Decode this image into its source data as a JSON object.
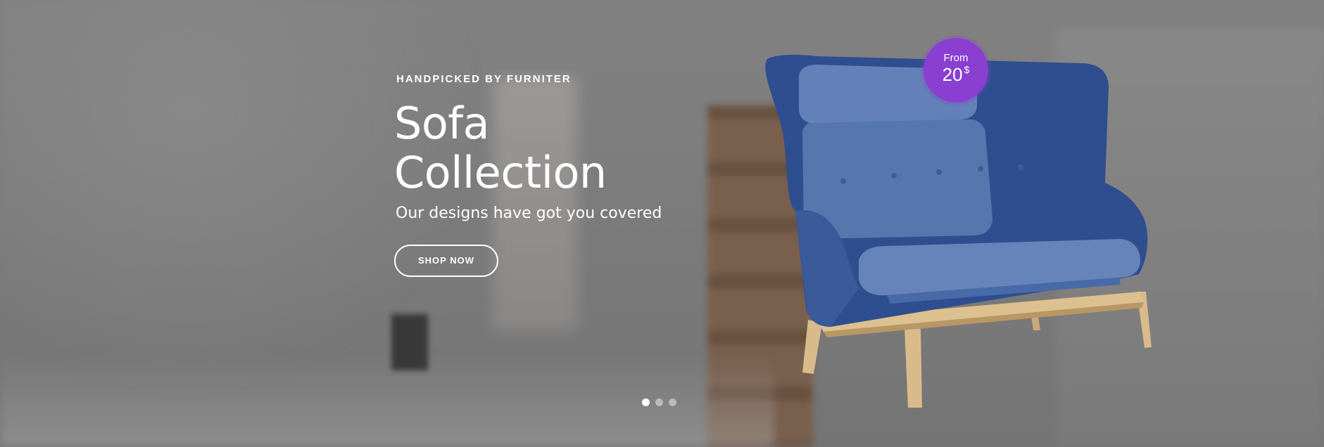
{
  "hero": {
    "eyebrow": "HANDPICKED BY FURNITER",
    "title_line1": "Sofa",
    "title_line2": "Collection",
    "subtitle": "Our designs have got you covered",
    "cta_label": "SHOP NOW"
  },
  "badge": {
    "from_label": "From",
    "amount": "20",
    "currency": "$",
    "color": "#8a3fd0"
  },
  "slider": {
    "dot_count": 3,
    "active_index": 0
  },
  "colors": {
    "sofa_fabric": "#3f5f9f",
    "sofa_cushion": "#5a78b0",
    "sofa_legs": "#d8b98a"
  }
}
